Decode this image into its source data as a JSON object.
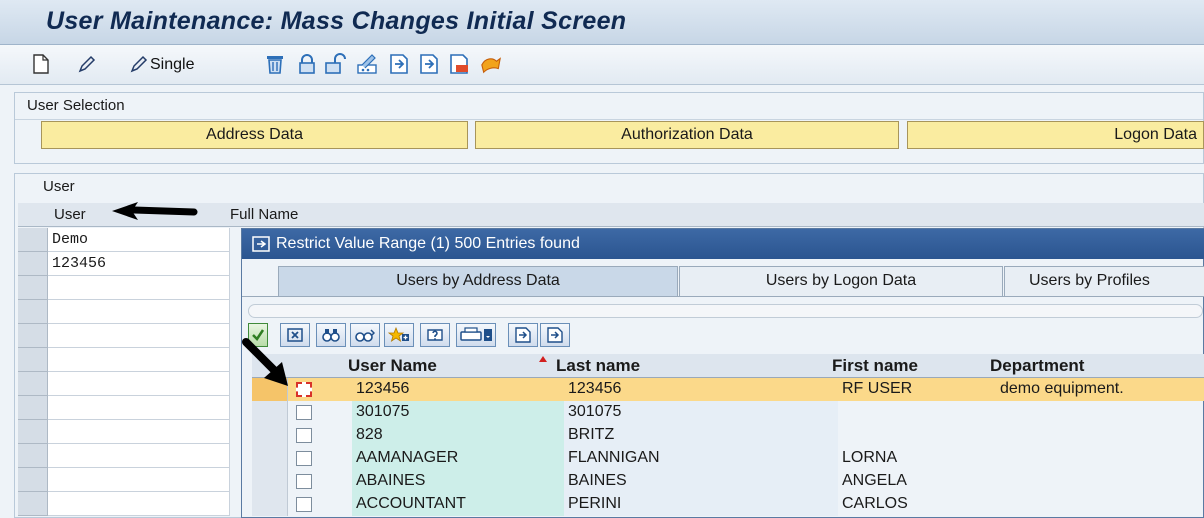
{
  "title": "User Maintenance: Mass Changes Initial Screen",
  "toolbar": {
    "single_label": "Single",
    "icons": [
      "new-icon",
      "edit-icon",
      "edit-single-icon",
      "delete-icon",
      "lock-icon",
      "unlock-icon",
      "password-icon",
      "import-icon",
      "export-icon",
      "transfer-icon",
      "clear-icon"
    ]
  },
  "selection": {
    "label": "User Selection",
    "buttons": [
      "Address Data",
      "Authorization Data",
      "Logon Data"
    ]
  },
  "user_table": {
    "title": "User",
    "columns": [
      "User",
      "Full Name"
    ],
    "rows": [
      "Demo",
      "123456"
    ]
  },
  "popup": {
    "title": "Restrict Value Range (1)  500 Entries found",
    "tabs": [
      "Users by Address Data",
      "Users by Logon Data",
      "Users by Profiles"
    ],
    "columns": [
      "User Name",
      "Last name",
      "First name",
      "Department"
    ],
    "rows": [
      {
        "user": "123456",
        "last": "123456",
        "first": "RF USER",
        "dept": "demo equipment."
      },
      {
        "user": "301075",
        "last": "301075",
        "first": "",
        "dept": ""
      },
      {
        "user": "828",
        "last": "BRITZ",
        "first": "",
        "dept": ""
      },
      {
        "user": "AAMANAGER",
        "last": "FLANNIGAN",
        "first": "LORNA",
        "dept": ""
      },
      {
        "user": "ABAINES",
        "last": "BAINES",
        "first": "ANGELA",
        "dept": ""
      },
      {
        "user": "ACCOUNTANT",
        "last": "PERINI",
        "first": "CARLOS",
        "dept": ""
      }
    ]
  },
  "colors": {
    "title_text": "#102a52",
    "popup_title_bg": "#2b5590",
    "tab_button_bg": "#faeca0",
    "selected_row_bg": "#fbd98a",
    "user_col_bg": "#cdeee9"
  }
}
